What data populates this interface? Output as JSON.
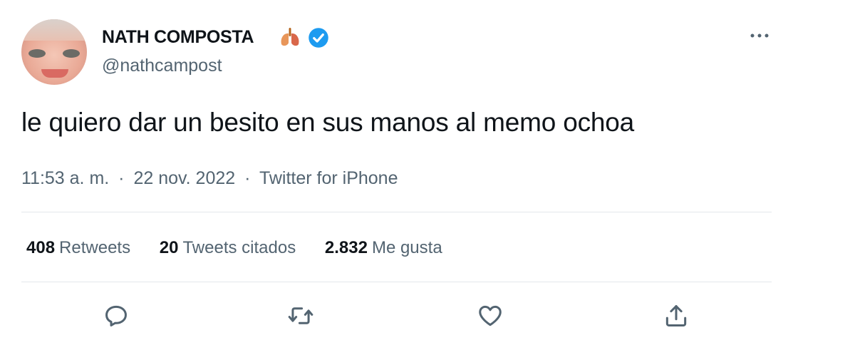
{
  "tweet": {
    "author": {
      "name": "NATH COMPOSTA",
      "handle": "@nathcampost",
      "emoji_icon": "lungs-emoji-icon",
      "verified_icon": "verified-badge-icon",
      "verified_color": "#1d9bf0"
    },
    "text": "le quiero dar un besito en sus manos al memo ochoa",
    "meta": {
      "time": "11:53 a. m.",
      "separator": "·",
      "date": "22 nov. 2022",
      "source": "Twitter for iPhone"
    },
    "stats": {
      "retweets_count": "408",
      "retweets_label": "Retweets",
      "quotes_count": "20",
      "quotes_label": "Tweets citados",
      "likes_count": "2.832",
      "likes_label": "Me gusta"
    },
    "actions": [
      "reply-icon",
      "retweet-icon",
      "like-icon",
      "share-icon"
    ],
    "more_icon": "more-options-icon"
  }
}
